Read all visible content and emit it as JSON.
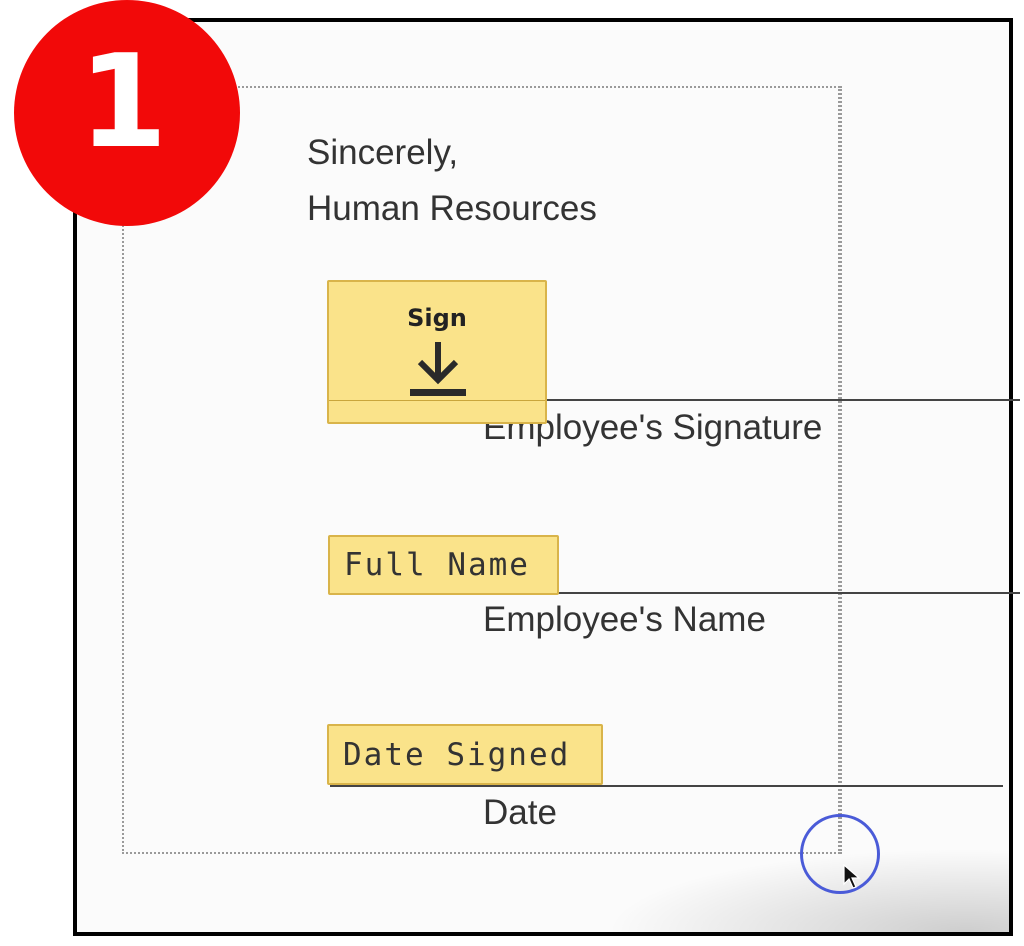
{
  "step_badge": {
    "number": "1",
    "color": "#f20909"
  },
  "letter": {
    "closing": "Sincerely,",
    "sender": "Human Resources"
  },
  "fields": {
    "sign": {
      "label": "Sign",
      "icon": "download-arrow-icon"
    },
    "full_name": {
      "label": "Full Name"
    },
    "date_signed": {
      "label": "Date Signed"
    }
  },
  "lines": {
    "signature_label": "Employee's Signature",
    "name_label": "Employee's Name",
    "date_label": "Date"
  },
  "colors": {
    "field_fill": "#fae38a",
    "field_border": "#d9b44a",
    "cursor_ring": "#4a5bd8"
  }
}
